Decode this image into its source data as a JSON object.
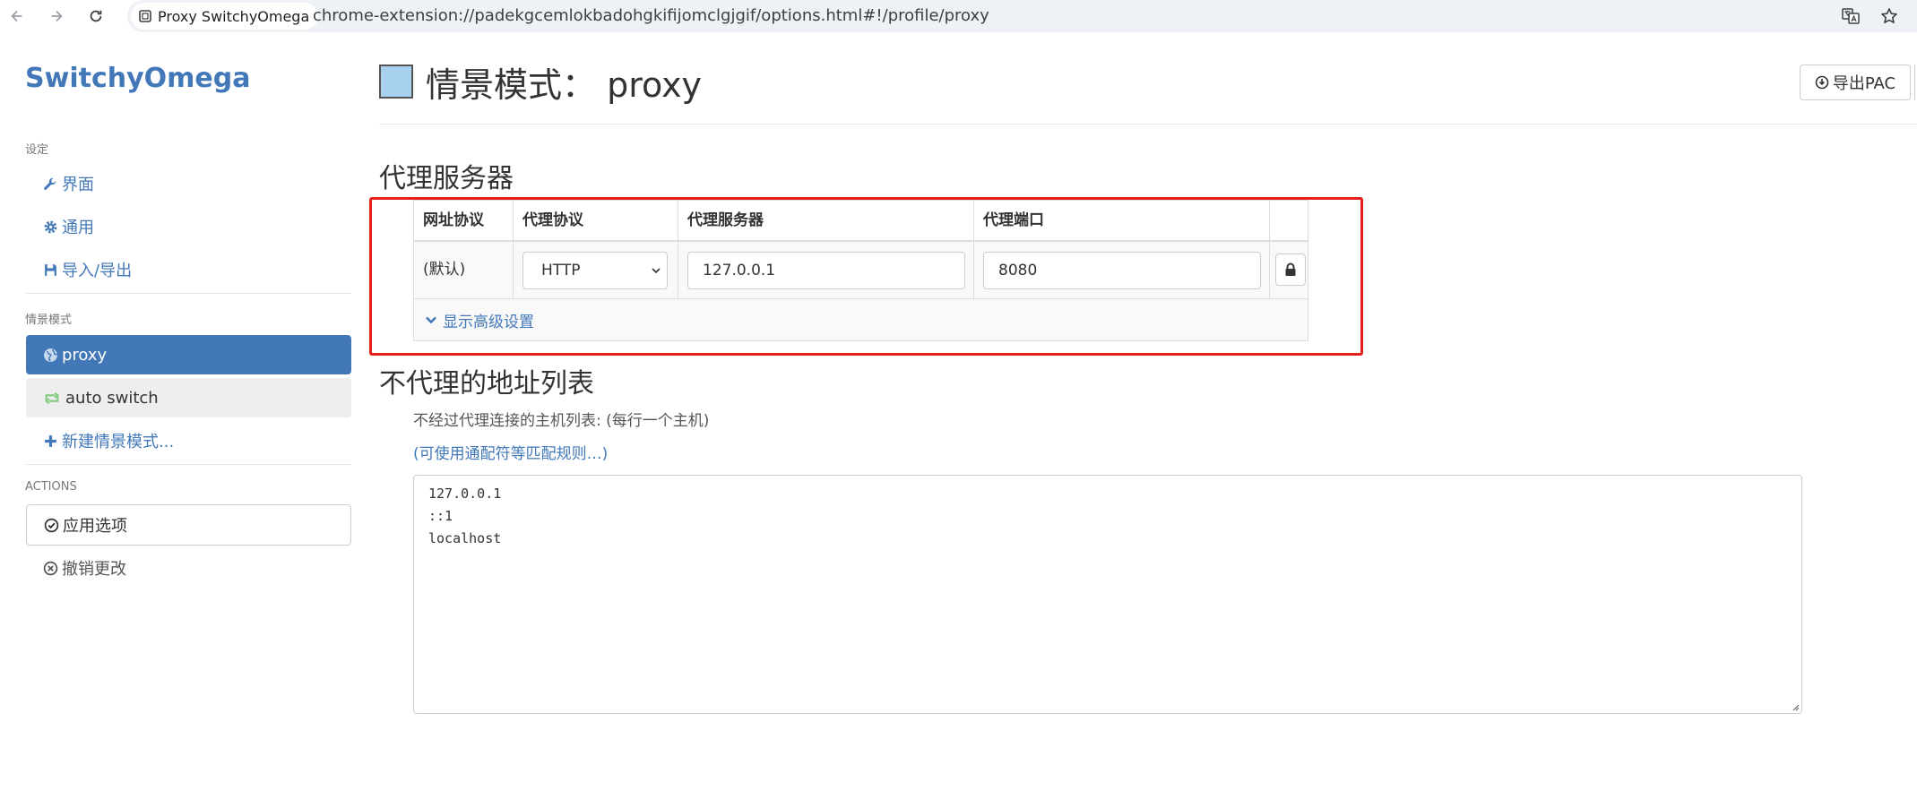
{
  "browser": {
    "tab_title": "Proxy SwitchyOmega",
    "url": "chrome-extension://padekgcemlokbadohgkifijomclgjgif/options.html#!/profile/proxy"
  },
  "sidebar": {
    "brand": "SwitchyOmega",
    "settings_header": "设定",
    "settings_items": [
      {
        "label": "界面",
        "icon": "wrench-icon"
      },
      {
        "label": "通用",
        "icon": "gear-icon"
      },
      {
        "label": "导入/导出",
        "icon": "save-icon"
      }
    ],
    "profiles_header": "情景模式",
    "profiles": [
      {
        "label": "proxy",
        "icon": "globe-icon",
        "active": true
      },
      {
        "label": "auto switch",
        "icon": "retweet-icon",
        "active": false
      }
    ],
    "new_profile_label": "新建情景模式...",
    "actions_header": "ACTIONS",
    "apply_label": "应用选项",
    "discard_label": "撤销更改"
  },
  "main": {
    "title": "情景模式： proxy",
    "profile_color": "#a8d0ef",
    "export_pac_label": "导出PAC",
    "proxy_section_title": "代理服务器",
    "table": {
      "headers": [
        "网址协议",
        "代理协议",
        "代理服务器",
        "代理端口"
      ],
      "row": {
        "scheme": "(默认)",
        "protocol": "HTTP",
        "server": "127.0.0.1",
        "port": "8080"
      },
      "advanced_label": "显示高级设置"
    },
    "bypass_section_title": "不代理的地址列表",
    "bypass_hint": "不经过代理连接的主机列表: (每行一个主机)",
    "bypass_link": "(可使用通配符等匹配规则…)",
    "bypass_list": [
      "127.0.0.1",
      "::1",
      "localhost"
    ]
  },
  "colors": {
    "accent": "#4278b8",
    "highlight": "#e3201b"
  }
}
